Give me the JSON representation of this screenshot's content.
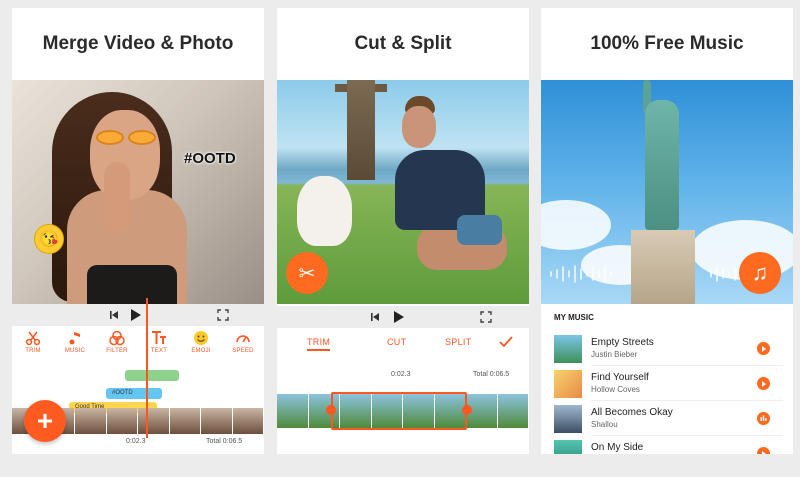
{
  "cards": {
    "merge": {
      "title": "Merge Video & Photo",
      "sticker_text": "#OOTD",
      "tools": [
        {
          "label": "TRIM",
          "icon": "scissors-icon"
        },
        {
          "label": "MUSIC",
          "icon": "music-note-icon"
        },
        {
          "label": "FILTER",
          "icon": "filter-icon"
        },
        {
          "label": "TEXT",
          "icon": "text-icon"
        },
        {
          "label": "EMOJI",
          "icon": "emoji-icon"
        },
        {
          "label": "SPEED",
          "icon": "speedometer-icon"
        }
      ],
      "tracks": {
        "text_track": "#OOTD",
        "music_track": "Good Time"
      },
      "current_time": "0:02.3",
      "total_time": "Total 0:06.5",
      "fab_label": "+"
    },
    "cut": {
      "title": "Cut & Split",
      "tabs": [
        "TRIM",
        "CUT",
        "SPLIT"
      ],
      "current_time": "0:02.3",
      "total_time": "Total 0:06.5"
    },
    "music": {
      "title": "100% Free Music",
      "section_label": "MY MUSIC",
      "songs": [
        {
          "title": "Empty Streets",
          "artist": "Justin Bieber"
        },
        {
          "title": "Find Yourself",
          "artist": "Hollow  Coves"
        },
        {
          "title": "All Becomes Okay",
          "artist": "Shallou"
        },
        {
          "title": "On My Side",
          "artist": ""
        }
      ]
    }
  },
  "colors": {
    "accent": "#ff5722",
    "fab": "#ff6a21",
    "text_track": "#4fc3f7",
    "music_track": "#ffd54f",
    "video_track": "#81c784"
  }
}
